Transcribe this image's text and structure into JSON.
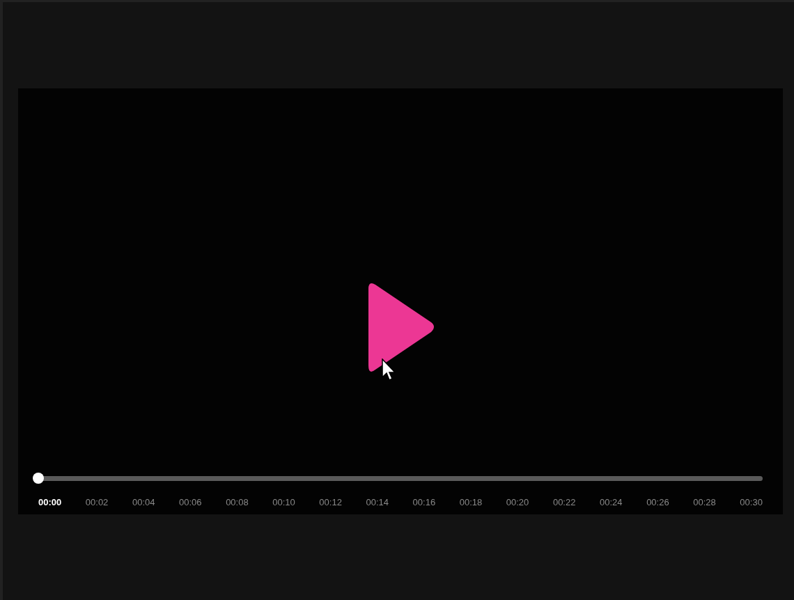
{
  "player": {
    "play_button": {
      "kind": "play"
    },
    "timeline": {
      "level": 0,
      "labels": [
        {
          "text": "00:00",
          "selected": true
        },
        {
          "text": "00:02",
          "selected": false
        },
        {
          "text": "00:04",
          "selected": false
        },
        {
          "text": "00:06",
          "selected": false
        },
        {
          "text": "00:08",
          "selected": false
        },
        {
          "text": "00:10",
          "selected": false
        },
        {
          "text": "00:12",
          "selected": false
        },
        {
          "text": "00:14",
          "selected": false
        },
        {
          "text": "00:16",
          "selected": false
        },
        {
          "text": "00:18",
          "selected": false
        },
        {
          "text": "00:20",
          "selected": false
        },
        {
          "text": "00:22",
          "selected": false
        },
        {
          "text": "00:24",
          "selected": false
        },
        {
          "text": "00:26",
          "selected": false
        },
        {
          "text": "00:28",
          "selected": false
        },
        {
          "text": "00:30",
          "selected": false
        }
      ]
    }
  }
}
